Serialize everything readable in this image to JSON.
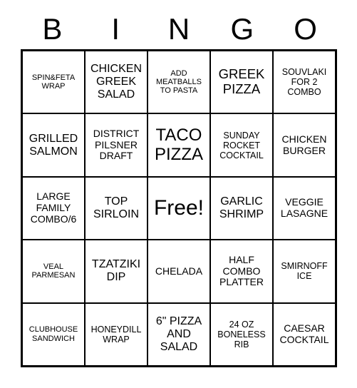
{
  "card": {
    "type": "bingo-card",
    "header": {
      "letters": [
        "B",
        "I",
        "N",
        "G",
        "O"
      ]
    },
    "grid": {
      "columns": 5,
      "rows": 5,
      "free_space_index": 12,
      "border_color": "#000000",
      "background_color": "#ffffff",
      "text_color": "#000000"
    },
    "cells": [
      {
        "text": "SPIN&FETA\nWRAP",
        "size": "xs",
        "column": "B",
        "row": 1
      },
      {
        "text": "CHICKEN\nGREEK\nSALAD",
        "size": "lg",
        "column": "I",
        "row": 1
      },
      {
        "text": "ADD\nMEATBALLS\nTO PASTA",
        "size": "xs",
        "column": "N",
        "row": 1
      },
      {
        "text": "GREEK\nPIZZA",
        "size": "xl",
        "column": "G",
        "row": 1
      },
      {
        "text": "SOUVLAKI\nFOR 2\nCOMBO",
        "size": "sm",
        "column": "O",
        "row": 1
      },
      {
        "text": "GRILLED\nSALMON",
        "size": "lg",
        "column": "B",
        "row": 2
      },
      {
        "text": "DISTRICT\nPILSNER\nDRAFT",
        "size": "md",
        "column": "I",
        "row": 2
      },
      {
        "text": "TACO\nPIZZA",
        "size": "xxl",
        "column": "N",
        "row": 2
      },
      {
        "text": "SUNDAY\nROCKET\nCOCKTAIL",
        "size": "sm",
        "column": "G",
        "row": 2
      },
      {
        "text": "CHICKEN\nBURGER",
        "size": "md",
        "column": "O",
        "row": 2
      },
      {
        "text": "LARGE\nFAMILY\nCOMBO/6",
        "size": "md",
        "column": "B",
        "row": 3
      },
      {
        "text": "TOP\nSIRLOIN",
        "size": "lg",
        "column": "I",
        "row": 3
      },
      {
        "text": "Free!",
        "size": "free",
        "column": "N",
        "row": 3
      },
      {
        "text": "GARLIC\nSHRIMP",
        "size": "lg",
        "column": "G",
        "row": 3
      },
      {
        "text": "VEGGIE\nLASAGNE",
        "size": "md",
        "column": "O",
        "row": 3
      },
      {
        "text": "VEAL\nPARMESAN",
        "size": "xs",
        "column": "B",
        "row": 4
      },
      {
        "text": "TZATZIKI\nDIP",
        "size": "lg",
        "column": "I",
        "row": 4
      },
      {
        "text": "CHELADA",
        "size": "md",
        "column": "N",
        "row": 4
      },
      {
        "text": "HALF\nCOMBO\nPLATTER",
        "size": "md",
        "column": "G",
        "row": 4
      },
      {
        "text": "SMIRNOFF\nICE",
        "size": "sm",
        "column": "O",
        "row": 4
      },
      {
        "text": "CLUBHOUSE\nSANDWICH",
        "size": "xs",
        "column": "B",
        "row": 5
      },
      {
        "text": "HONEYDILL\nWRAP",
        "size": "sm",
        "column": "I",
        "row": 5
      },
      {
        "text": "6\" PIZZA\nAND\nSALAD",
        "size": "lg",
        "column": "N",
        "row": 5
      },
      {
        "text": "24 OZ\nBONELESS\nRIB",
        "size": "sm",
        "column": "G",
        "row": 5
      },
      {
        "text": "CAESAR\nCOCKTAIL",
        "size": "md",
        "column": "O",
        "row": 5
      }
    ]
  }
}
